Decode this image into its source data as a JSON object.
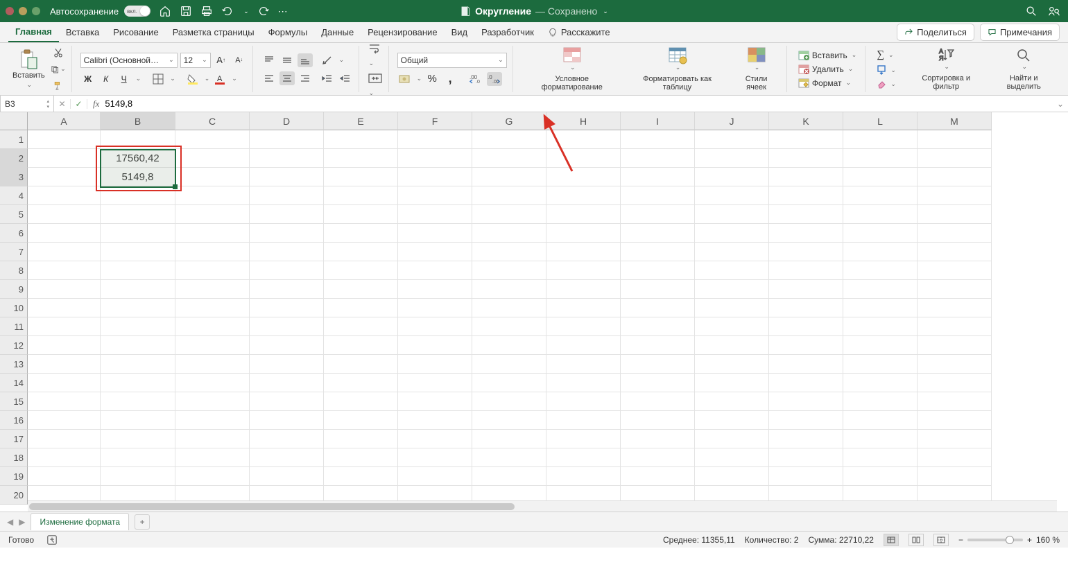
{
  "titlebar": {
    "autosave_label": "Автосохранение",
    "autosave_on": "вкл.",
    "filename": "Округление",
    "saved": "— Сохранено"
  },
  "tabs": {
    "items": [
      "Главная",
      "Вставка",
      "Рисование",
      "Разметка страницы",
      "Формулы",
      "Данные",
      "Рецензирование",
      "Вид",
      "Разработчик"
    ],
    "tell_me": "Расскажите",
    "share": "Поделиться",
    "comments": "Примечания"
  },
  "ribbon": {
    "paste": "Вставить",
    "font_name": "Calibri (Основной…",
    "font_size": "12",
    "number_format": "Общий",
    "cond_format": "Условное форматирование",
    "format_table": "Форматировать как таблицу",
    "cell_styles": "Стили ячеек",
    "insert": "Вставить",
    "delete": "Удалить",
    "format": "Формат",
    "sort_filter": "Сортировка и фильтр",
    "find_select": "Найти и выделить"
  },
  "formula_bar": {
    "cell_ref": "B3",
    "fx": "fx",
    "value": "5149,8"
  },
  "grid": {
    "columns": [
      "A",
      "B",
      "C",
      "D",
      "E",
      "F",
      "G",
      "H",
      "I",
      "J",
      "K",
      "L",
      "M"
    ],
    "row_count": 20,
    "cells": {
      "B2": "17560,42",
      "B3": "5149,8"
    }
  },
  "sheets": {
    "active": "Изменение формата"
  },
  "status": {
    "ready": "Готово",
    "avg_label": "Среднее:",
    "avg": "11355,11",
    "count_label": "Количество:",
    "count": "2",
    "sum_label": "Сумма:",
    "sum": "22710,22",
    "zoom": "160 %"
  }
}
